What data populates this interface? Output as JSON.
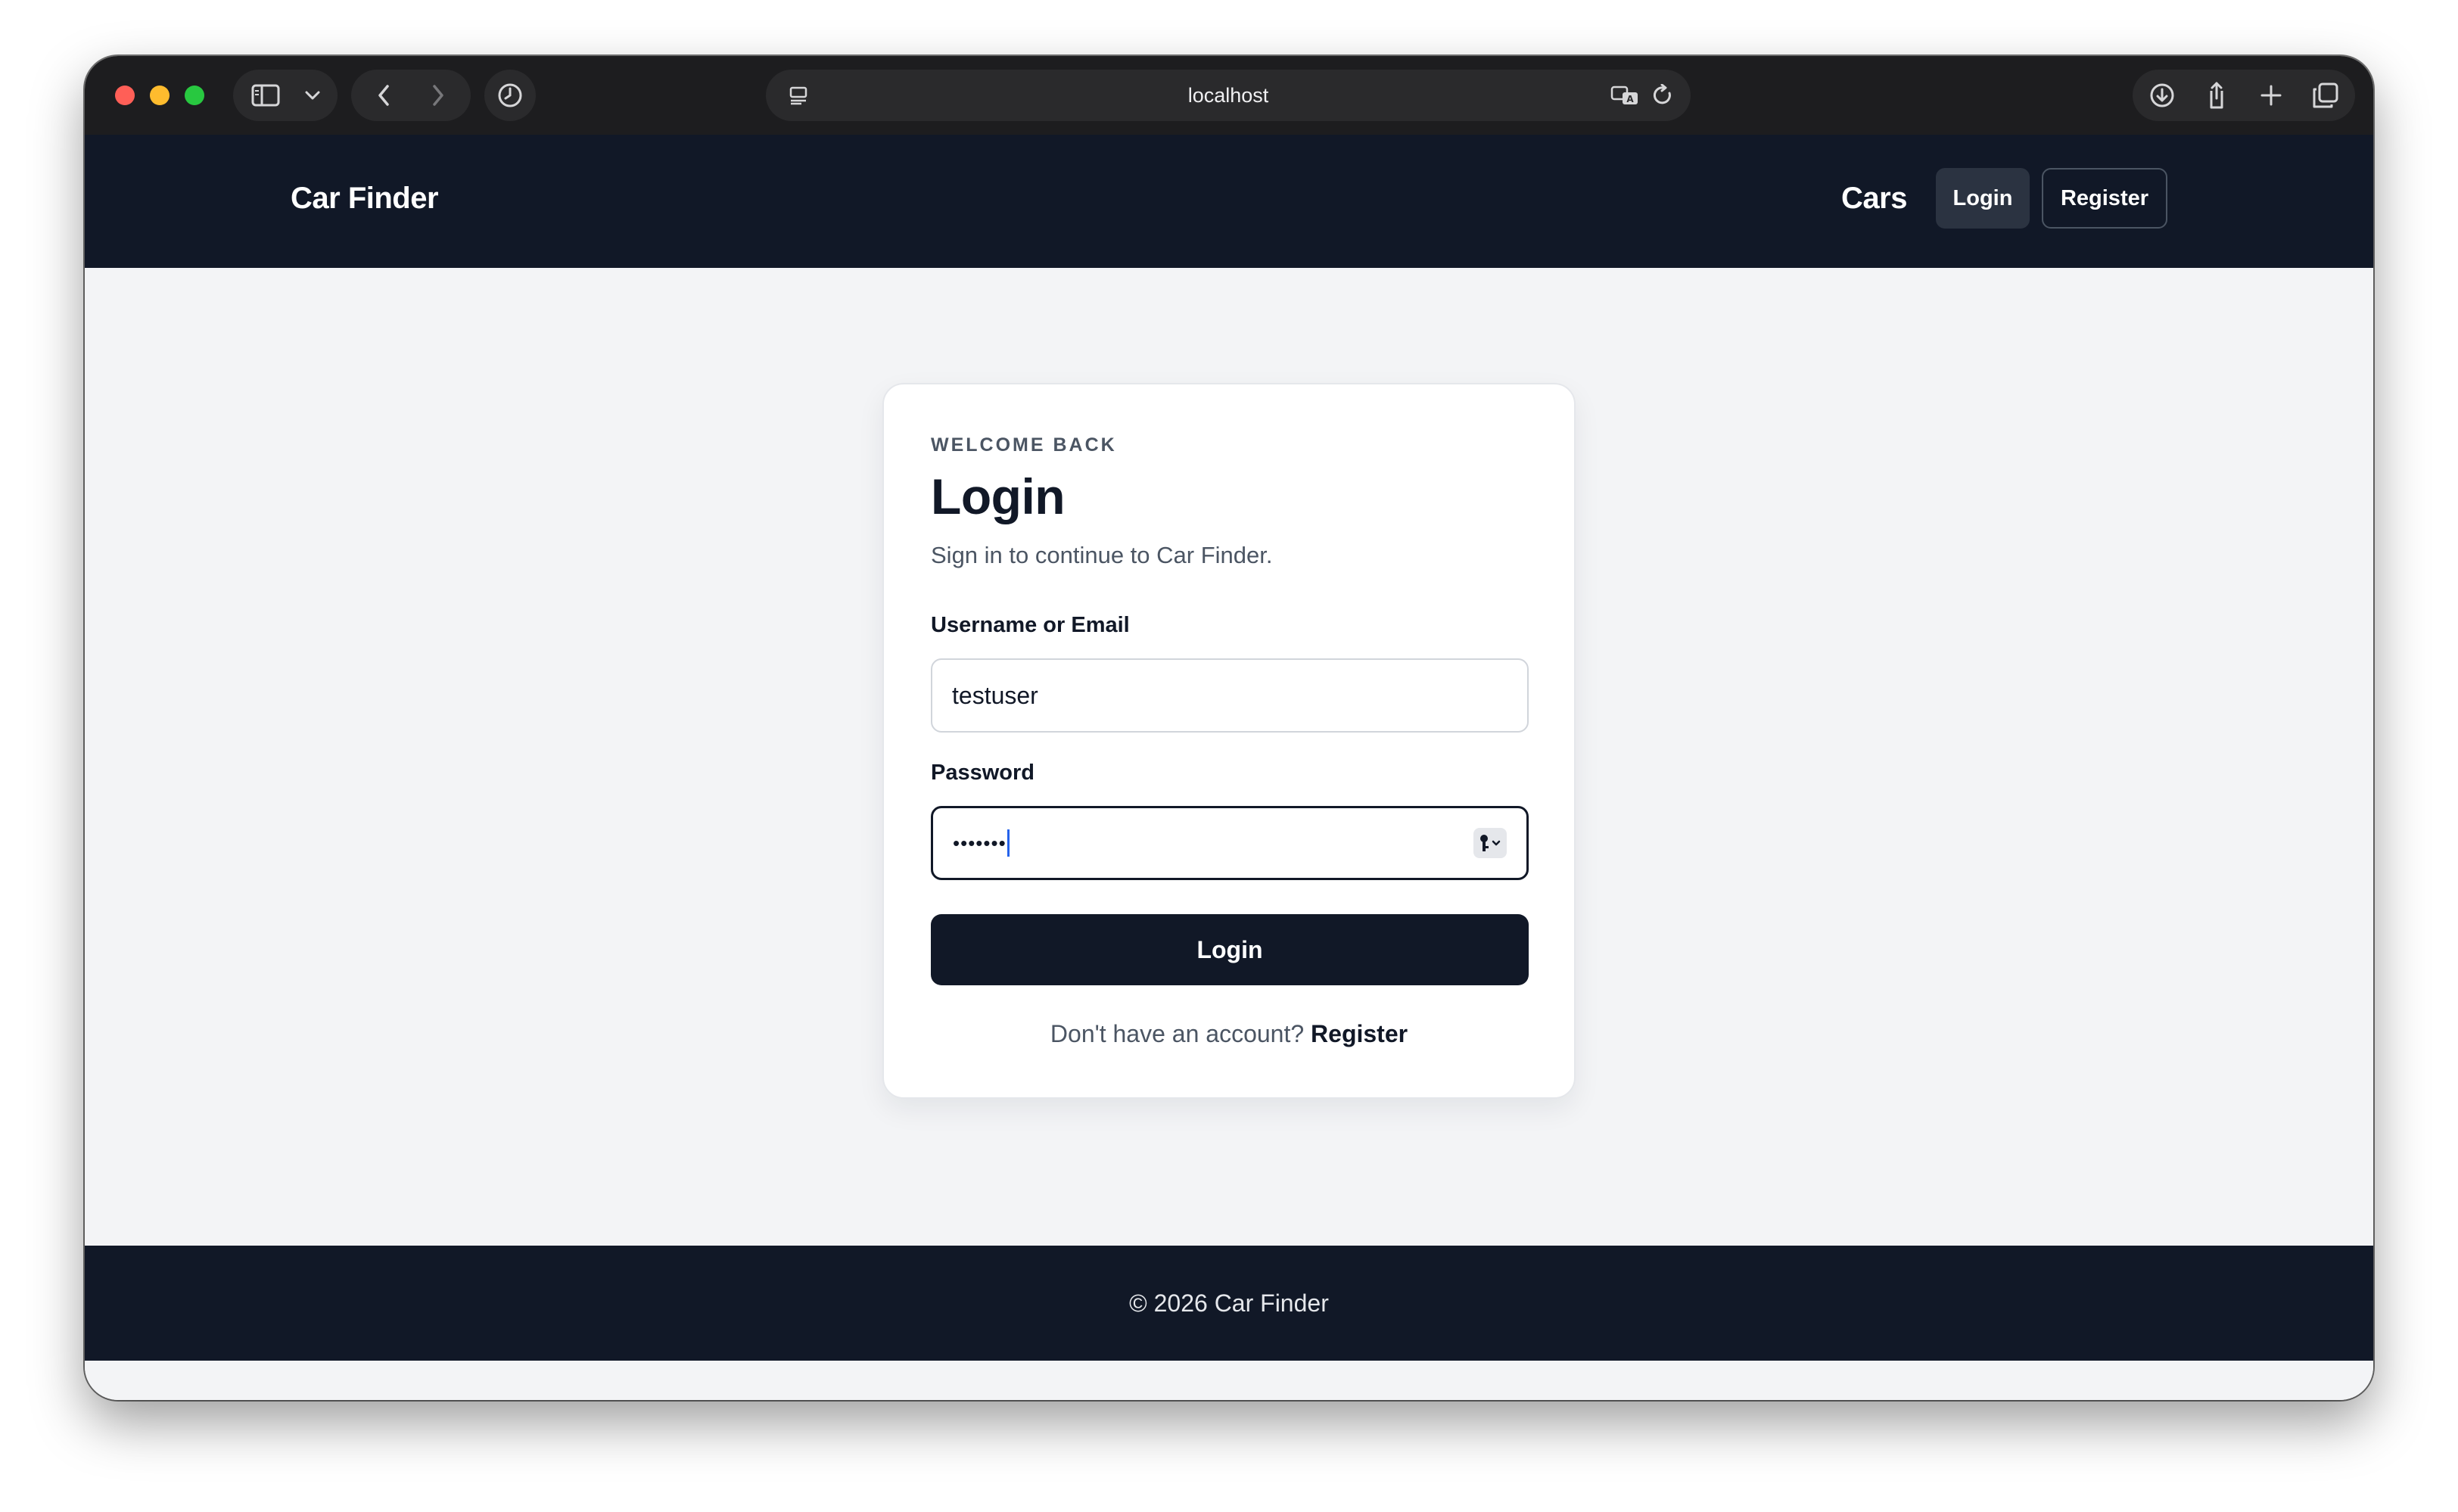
{
  "browser": {
    "url": "localhost",
    "icons": {
      "sidebar": "sidebar-icon",
      "tab_menu": "chevron-down-icon",
      "back": "chevron-left-icon",
      "forward": "chevron-right-icon",
      "history": "clock-icon",
      "page_menu": "page-menu-icon",
      "translate": "translate-icon",
      "reload": "reload-icon",
      "download": "download-icon",
      "share": "share-icon",
      "new_tab": "plus-icon",
      "tabs": "tab-overview-icon"
    }
  },
  "header": {
    "brand": "Car Finder",
    "nav": {
      "cars": "Cars",
      "login": "Login",
      "register": "Register"
    }
  },
  "login_card": {
    "eyebrow": "WELCOME BACK",
    "title": "Login",
    "subtitle": "Sign in to continue to Car Finder.",
    "username_label": "Username or Email",
    "username_value": "testuser",
    "password_label": "Password",
    "password_masked": "•••••••",
    "submit_label": "Login",
    "switch_prompt": "Don't have an account?",
    "switch_link": "Register"
  },
  "footer": {
    "text": "© 2026 Car Finder"
  },
  "colors": {
    "header_bg": "#111827",
    "page_bg": "#f3f4f6",
    "primary_button": "#111827",
    "caret": "#2563eb"
  }
}
